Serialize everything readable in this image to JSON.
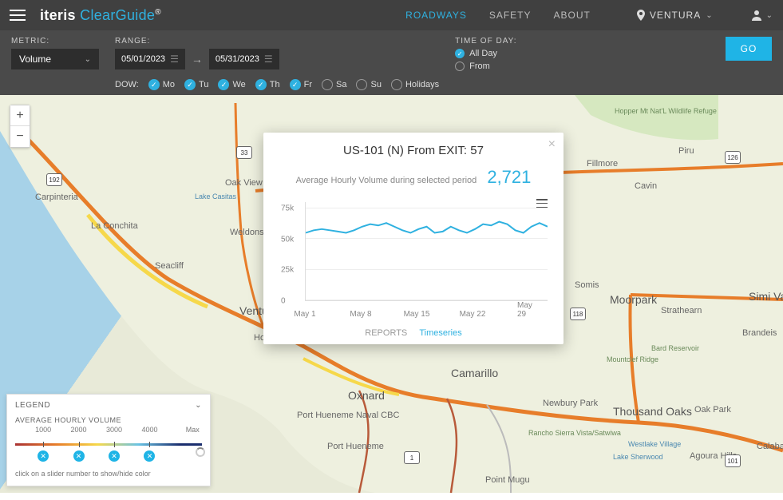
{
  "brand": {
    "left": "iteris",
    "right": "ClearGuide"
  },
  "nav": {
    "roadways": "ROADWAYS",
    "safety": "SAFETY",
    "about": "ABOUT"
  },
  "location": "VENTURA",
  "filters": {
    "metric_label": "METRIC:",
    "metric_value": "Volume",
    "range_label": "RANGE:",
    "date_from": "05/01/2023",
    "date_to": "05/31/2023",
    "dow_label": "DOW:",
    "dow": [
      {
        "abbr": "Mo",
        "on": true
      },
      {
        "abbr": "Tu",
        "on": true
      },
      {
        "abbr": "We",
        "on": true
      },
      {
        "abbr": "Th",
        "on": true
      },
      {
        "abbr": "Fr",
        "on": true
      },
      {
        "abbr": "Sa",
        "on": false
      },
      {
        "abbr": "Su",
        "on": false
      },
      {
        "abbr": "Holidays",
        "on": false
      }
    ],
    "tod_label": "TIME OF DAY:",
    "tod_allday": "All Day",
    "tod_from": "From",
    "go": "GO"
  },
  "popup": {
    "title": "US-101 (N) From EXIT: 57",
    "subtitle": "Average Hourly Volume during selected period",
    "value": "2,721",
    "tabs": {
      "reports": "REPORTS",
      "timeseries": "Timeseries"
    }
  },
  "chart_data": {
    "type": "line",
    "title": "US-101 (N) From EXIT: 57",
    "ylabel": "",
    "xlabel": "",
    "ylim": [
      0,
      80000
    ],
    "yticks": [
      0,
      25000,
      50000,
      75000
    ],
    "ytick_labels": [
      "0",
      "25k",
      "50k",
      "75k"
    ],
    "xtick_labels": [
      "May 1",
      "May 8",
      "May 15",
      "May 22",
      "May 29"
    ],
    "x": [
      1,
      2,
      3,
      4,
      5,
      6,
      7,
      8,
      9,
      10,
      11,
      12,
      13,
      14,
      15,
      16,
      17,
      18,
      19,
      20,
      21,
      22,
      23,
      24,
      25,
      26,
      27,
      28,
      29,
      30,
      31
    ],
    "values": [
      55000,
      57000,
      58000,
      57000,
      56000,
      55000,
      57000,
      60000,
      62000,
      61000,
      63000,
      60000,
      57000,
      55000,
      58000,
      60000,
      55000,
      56000,
      60000,
      57000,
      55000,
      58000,
      62000,
      61000,
      64000,
      62000,
      57000,
      55000,
      60000,
      63000,
      60000
    ]
  },
  "legend": {
    "title": "LEGEND",
    "metric": "AVERAGE HOURLY VOLUME",
    "ticks": [
      "1000",
      "2000",
      "3000",
      "4000",
      "Max"
    ],
    "hint": "click on a slider number to show/hide color"
  },
  "places": {
    "carpinteria": "Carpinteria",
    "la_conchita": "La Conchita",
    "oak_view": "Oak View",
    "lake_casitas": "Lake Casitas",
    "weldons": "Weldons",
    "seacliff": "Seacliff",
    "ventura": "Ventura",
    "hollywd": "HollyWd Bch",
    "oxnard": "Oxnard",
    "pt_hueneme_cbc": "Port Hueneme Naval CBC",
    "pt_hueneme": "Port Hueneme",
    "camarillo": "Camarillo",
    "fillmore": "Fillmore",
    "piru": "Piru",
    "cavin": "Cavin",
    "somis": "Somis",
    "moorpark": "Moorpark",
    "strathearn": "Strathearn",
    "simi": "Simi Valley",
    "brandeis": "Brandeis",
    "newbury": "Newbury Park",
    "thousand_oaks": "Thousand Oaks",
    "oak_park": "Oak Park",
    "agoura": "Agoura Hills",
    "westlake": "Westlake Village",
    "calabas": "Calabas",
    "hopper": "Hopper Mt Nat'L Wildlife Refuge",
    "rancho": "Rancho Sierra Vista/Satwiwa",
    "bard": "Bard Reservoir",
    "mountclef": "Mountclef Ridge",
    "lake_sherwood": "Lake Sherwood",
    "pt_mugu": "Point Mugu"
  }
}
